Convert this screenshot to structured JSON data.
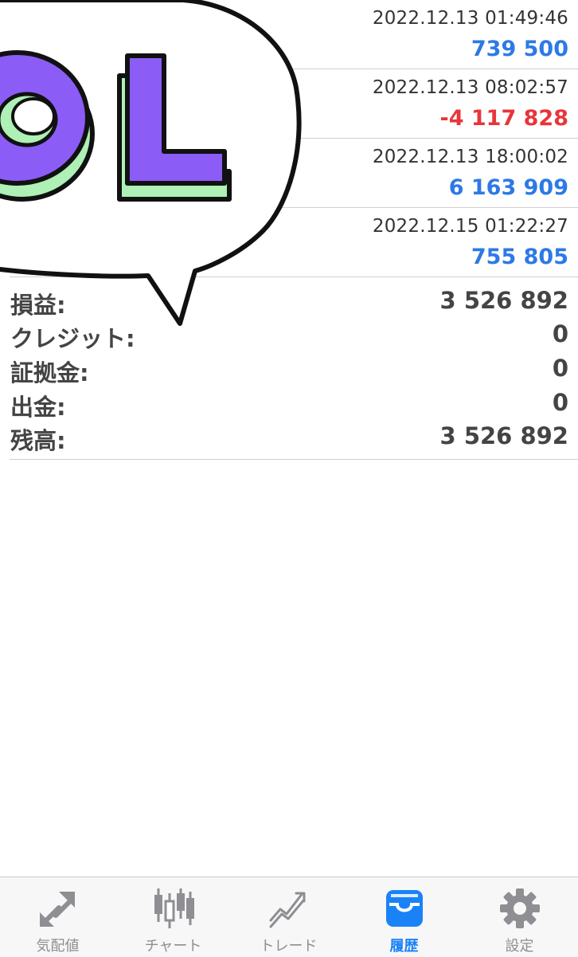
{
  "deals": [
    {
      "time": "2022.12.13 01:49:46",
      "profit": "739 500",
      "sign": "positive"
    },
    {
      "time": "2022.12.13 08:02:57",
      "profit": "-4 117 828",
      "sign": "negative"
    },
    {
      "time": "2022.12.13 18:00:02",
      "profit": "6 163 909",
      "sign": "positive"
    },
    {
      "time": "2022.12.15 01:22:27",
      "profit": "755 805",
      "sign": "positive"
    }
  ],
  "summary": {
    "profit_label": "損益:",
    "profit_value": "3 526 892",
    "credit_label": "クレジット:",
    "credit_value": "0",
    "margin_label": "証拠金:",
    "margin_value": "0",
    "withdrawal_label": "出金:",
    "withdrawal_value": "0",
    "balance_label": "残高:",
    "balance_value": "3 526 892"
  },
  "sticker": {
    "text": "OL",
    "icon": "speech-bubble-sticker"
  },
  "tabs": [
    {
      "label": "気配値",
      "icon": "quotes-arrows-icon",
      "active": false
    },
    {
      "label": "チャート",
      "icon": "candlestick-chart-icon",
      "active": false
    },
    {
      "label": "トレード",
      "icon": "trade-line-icon",
      "active": false
    },
    {
      "label": "履歴",
      "icon": "inbox-tray-icon",
      "active": true
    },
    {
      "label": "設定",
      "icon": "gear-icon",
      "active": false
    }
  ],
  "colors": {
    "positive": "#2d79e6",
    "negative": "#e8353b",
    "active_tab": "#1a82f7",
    "inactive_tab": "#8e8e93"
  }
}
